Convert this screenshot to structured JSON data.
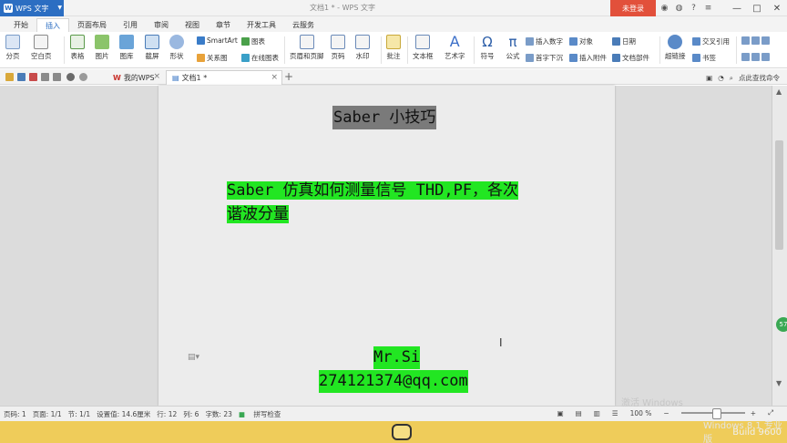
{
  "titlebar": {
    "app_name": "WPS 文字",
    "document_title": "文档1 * - WPS 文字",
    "login_label": "未登录"
  },
  "menu_tabs": [
    "开始",
    "插入",
    "页面布局",
    "引用",
    "审阅",
    "视图",
    "章节",
    "开发工具",
    "云服务"
  ],
  "active_tab": "插入",
  "ribbon": {
    "page_break": "分页",
    "blank_page": "空白页",
    "table": "表格",
    "picture": "图片",
    "gallery": "图库",
    "screenshot": "截屏",
    "shapes": "形状",
    "smartart": "SmartArt",
    "relation_chart": "关系图",
    "chart": "图表",
    "online_chart": "在线图表",
    "header_footer": "页眉和页脚",
    "page_number": "页码",
    "watermark": "水印",
    "comment": "批注",
    "textbox": "文本框",
    "wordart": "艺术字",
    "symbol": "符号",
    "formula": "公式",
    "insert_number": "插入数字",
    "object": "对象",
    "date": "日期",
    "drop_cap": "首字下沉",
    "insert_attachment": "插入附件",
    "doc_parts": "文档部件",
    "hyperlink": "超链接",
    "cross_reference": "交叉引用",
    "bookmark": "书签"
  },
  "quickbar": {
    "wps_tab": "我的WPS",
    "doc_tab": "文档1 *",
    "help_text": "点此查找命令"
  },
  "document": {
    "title": "Saber 小技巧",
    "heading_line1": "Saber 仿真如何测量信号 THD,PF，各次",
    "heading_line2": "谐波分量",
    "author": "Mr.Si",
    "email": "274121374@qq.com"
  },
  "statusbar": {
    "page": "页码: 1",
    "pages": "页面: 1/1",
    "section": "节: 1/1",
    "position": "设置值: 14.6厘米",
    "row": "行: 12",
    "column": "列: 6",
    "word_count": "字数: 23",
    "spellcheck": "拼写检查",
    "zoom": "100 %"
  },
  "overlay": {
    "activate_windows": "激活 Windows",
    "os_version": "Windows 8.1 专业版",
    "build": "Build 9600"
  },
  "colors": {
    "highlight_green": "#22e622",
    "title_gray": "#7a7a7a",
    "brand_blue": "#2c6ec2",
    "login_red": "#e2503b",
    "taskbar_yellow": "#efcc5a"
  }
}
